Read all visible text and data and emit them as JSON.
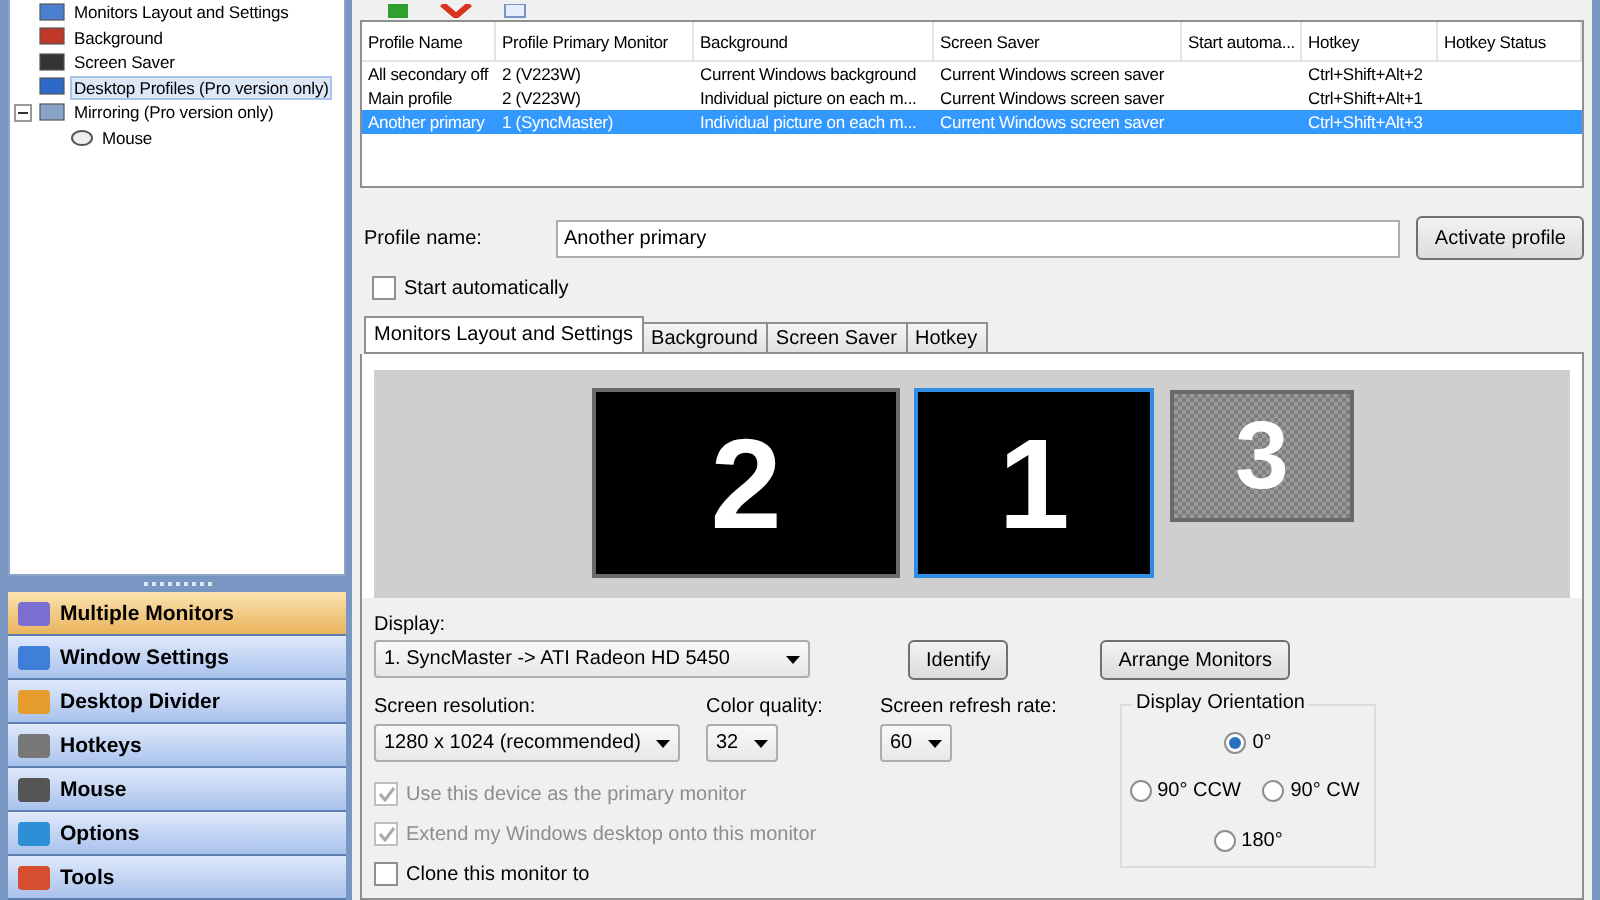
{
  "tree": [
    {
      "label": "Monitors Layout and Settings"
    },
    {
      "label": "Background"
    },
    {
      "label": "Screen Saver"
    },
    {
      "label": "Desktop Profiles (Pro version only)",
      "selected": true
    },
    {
      "label": "Mirroring (Pro version only)",
      "expanded": true,
      "children": [
        {
          "label": "Mouse"
        }
      ]
    }
  ],
  "nav": [
    {
      "label": "Multiple Monitors",
      "selected": true
    },
    {
      "label": "Window Settings",
      "selected": false
    },
    {
      "label": "Desktop Divider",
      "selected": false
    },
    {
      "label": "Hotkeys",
      "selected": false
    },
    {
      "label": "Mouse",
      "selected": false
    },
    {
      "label": "Options",
      "selected": false
    },
    {
      "label": "Tools",
      "selected": false
    }
  ],
  "table": {
    "columns": [
      "Profile Name",
      "Profile Primary Monitor",
      "Background",
      "Screen Saver",
      "Start automa...",
      "Hotkey",
      "Hotkey Status"
    ],
    "rows": [
      {
        "cells": [
          "All secondary off",
          "2 (V223W)",
          "Current Windows background",
          "Current Windows screen saver",
          "",
          "Ctrl+Shift+Alt+2",
          ""
        ],
        "selected": false
      },
      {
        "cells": [
          "Main profile",
          "2 (V223W)",
          "Individual picture on each m...",
          "Current Windows screen saver",
          "",
          "Ctrl+Shift+Alt+1",
          ""
        ],
        "selected": false
      },
      {
        "cells": [
          "Another primary",
          "1 (SyncMaster)",
          "Individual picture on each m...",
          "Current Windows screen saver",
          "",
          "Ctrl+Shift+Alt+3",
          ""
        ],
        "selected": true
      }
    ]
  },
  "profile": {
    "label": "Profile name:",
    "value": "Another primary",
    "button": "Activate profile",
    "start_auto": {
      "label": "Start automatically",
      "checked": false
    }
  },
  "tabs": [
    {
      "label": "Monitors Layout and Settings",
      "selected": true
    },
    {
      "label": "Background",
      "selected": false
    },
    {
      "label": "Screen Saver",
      "selected": false
    },
    {
      "label": "Hotkey",
      "selected": false
    }
  ],
  "monitors": [
    {
      "label": "2",
      "selected": false,
      "disabled": false
    },
    {
      "label": "1",
      "selected": true,
      "disabled": false
    },
    {
      "label": "3",
      "selected": false,
      "disabled": true
    }
  ],
  "display": {
    "label": "Display:",
    "value": "1. SyncMaster -> ATI Radeon HD 5450"
  },
  "identify": "Identify",
  "arrange": "Arrange Monitors",
  "resolution": {
    "label": "Screen resolution:",
    "value": "1280 x 1024 (recommended)"
  },
  "color_quality": {
    "label": "Color quality:",
    "value": "32"
  },
  "refresh": {
    "label": "Screen refresh rate:",
    "value": "60"
  },
  "checks": [
    {
      "label": "Use this device as the primary monitor",
      "checked": true,
      "disabled": true
    },
    {
      "label": "Extend my Windows desktop onto this monitor",
      "checked": true,
      "disabled": true
    },
    {
      "label": "Clone this monitor to",
      "checked": false,
      "disabled": false
    }
  ],
  "orientation": {
    "title": "Display Orientation",
    "options": [
      {
        "label": "0°",
        "selected": true
      },
      {
        "label": "90° CCW",
        "selected": false
      },
      {
        "label": "90° CW",
        "selected": false
      },
      {
        "label": "180°",
        "selected": false
      }
    ]
  }
}
